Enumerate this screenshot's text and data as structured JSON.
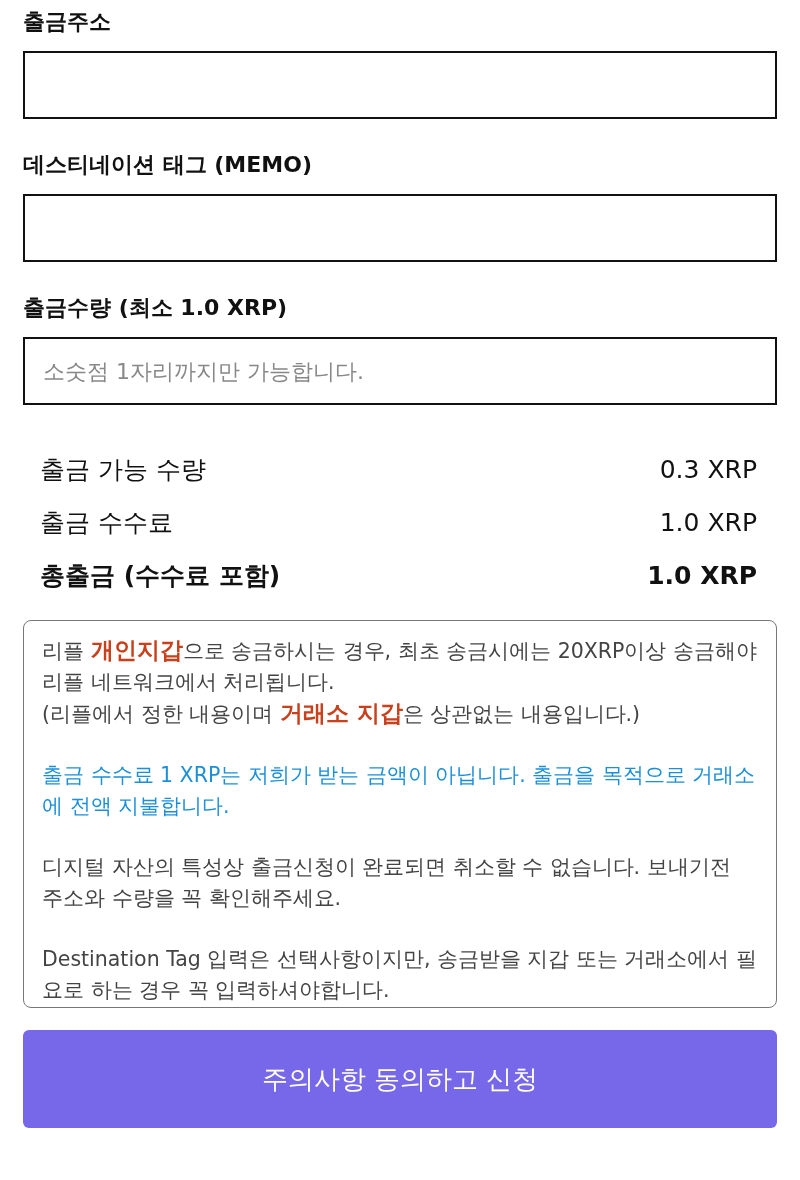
{
  "fields": [
    {
      "label": "출금주소"
    },
    {
      "label": "데스티네이션 태그 (MEMO)"
    },
    {
      "label": "출금수량 (최소 1.0 XRP)",
      "placeholder": "소숫점 1자리까지만 가능합니다."
    }
  ],
  "summary": [
    {
      "label": "출금 가능 수량",
      "value": "0.3 XRP",
      "kind": "normal"
    },
    {
      "label": "출금 수수료",
      "value": "1.0 XRP",
      "kind": "normal"
    },
    {
      "label": "총출금 (수수료 포함)",
      "value": "1.0 XRP",
      "kind": "total"
    }
  ],
  "notice": [
    {
      "kind": "normal",
      "lines": [
        "리플 **개인지갑**으로 송금하시는 경우, 최초 송금시에는 20XRP이상 송금해야 리플 네트워크에서 처리됩니다.",
        "(리플에서 정한 내용이며 **거래소 지갑**은 상관없는 내용입니다.)"
      ]
    },
    {
      "kind": "info",
      "lines": [
        "출금 수수료 1 XRP는 저희가 받는 금액이 아닙니다. 출금을 목적으로 거래소에 전액 지불합니다."
      ]
    },
    {
      "kind": "normal",
      "lines": [
        "디지털 자산의 특성상 출금신청이 완료되면 취소할 수 없습니다. 보내기전 주소와 수량을 꼭 확인해주세요."
      ]
    },
    {
      "kind": "normal",
      "lines": [
        "Destination Tag 입력은 선택사항이지만, 송금받을 지갑 또는 거래소에서 필요로 하는 경우 꼭 입력하셔야합니다."
      ]
    }
  ],
  "submit_button": "주의사항 동의하고 신청"
}
